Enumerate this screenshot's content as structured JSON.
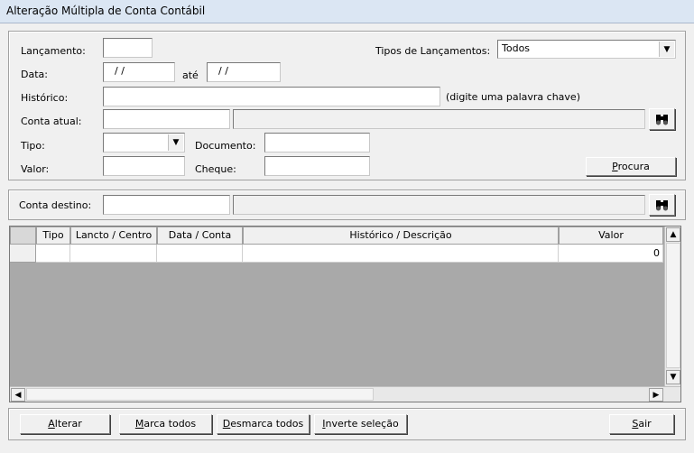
{
  "window": {
    "title": "Alteração Múltipla de Conta Contábil"
  },
  "filters": {
    "lancamento_label": "Lançamento:",
    "lancamento_value": "",
    "tipos_label": "Tipos de Lançamentos:",
    "tipos_value": "Todos",
    "data_label": "Data:",
    "data_from": "/ /",
    "ate_label": "até",
    "data_to": "/ /",
    "historico_label": "Histórico:",
    "historico_value": "",
    "historico_hint": "(digite uma palavra chave)",
    "conta_atual_label": "Conta atual:",
    "conta_atual_value": "",
    "conta_atual_desc": "",
    "tipo_label": "Tipo:",
    "tipo_value": "",
    "documento_label": "Documento:",
    "documento_value": "",
    "valor_label": "Valor:",
    "valor_value": "",
    "cheque_label": "Cheque:",
    "cheque_value": "",
    "procura_label": "Procura",
    "procura_hotkey": "P",
    "procura_rest": "rocura"
  },
  "destino": {
    "label": "Conta destino:",
    "value": "",
    "desc": ""
  },
  "grid": {
    "columns": [
      "Tipo",
      "Lancto / Centro",
      "Data / Conta",
      "Histórico / Descrição",
      "Valor"
    ],
    "rows": [
      {
        "tipo": "",
        "lancto": "",
        "data": "",
        "historico": "",
        "valor": "0"
      }
    ]
  },
  "buttons": {
    "alterar": {
      "hot": "A",
      "rest": "lterar"
    },
    "marca_todos": {
      "hot": "M",
      "rest": "arca todos"
    },
    "desmarca_todos": {
      "hot": "D",
      "rest": "esmarca todos"
    },
    "inverte_selecao": {
      "hot": "I",
      "rest": "nverte seleção"
    },
    "sair": {
      "hot": "S",
      "rest": "air"
    }
  },
  "icons": {
    "find": "binoculars-icon",
    "dropdown": "chevron-down-icon"
  }
}
